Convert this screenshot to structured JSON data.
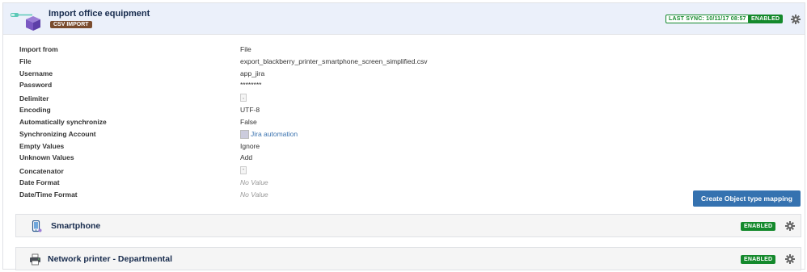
{
  "header": {
    "title": "Import office equipment",
    "badge": "CSV IMPORT",
    "last_sync": "LAST SYNC: 10/11/17 08:57",
    "status": "ENABLED"
  },
  "properties": [
    {
      "key": "Import from",
      "value": "File"
    },
    {
      "key": "File",
      "value": "export_blackberry_printer_smartphone_screen_simplified.csv"
    },
    {
      "key": "Username",
      "value": "app_jira"
    },
    {
      "key": "Password",
      "value": "********"
    },
    {
      "key": "Delimiter",
      "value": ","
    },
    {
      "key": "Encoding",
      "value": "UTF-8"
    },
    {
      "key": "Automatically synchronize",
      "value": "False"
    },
    {
      "key": "Synchronizing Account",
      "value": "Jira automation"
    },
    {
      "key": "Empty Values",
      "value": "Ignore"
    },
    {
      "key": "Unknown Values",
      "value": "Add"
    },
    {
      "key": "Concatenator",
      "value": "-"
    },
    {
      "key": "Date Format",
      "value": "No Value"
    },
    {
      "key": "Date/Time Format",
      "value": "No Value"
    }
  ],
  "actions": {
    "create_mapping": "Create Object type mapping"
  },
  "object_types": [
    {
      "name": "Smartphone",
      "status": "ENABLED",
      "icon": "smartphone-icon"
    },
    {
      "name": "Network printer - Departmental",
      "status": "ENABLED",
      "icon": "printer-icon"
    }
  ],
  "colors": {
    "accent": "#3572b0",
    "enabled": "#14892c",
    "csv_badge": "#7a4c2e",
    "header_bg": "#ebf0fa"
  }
}
